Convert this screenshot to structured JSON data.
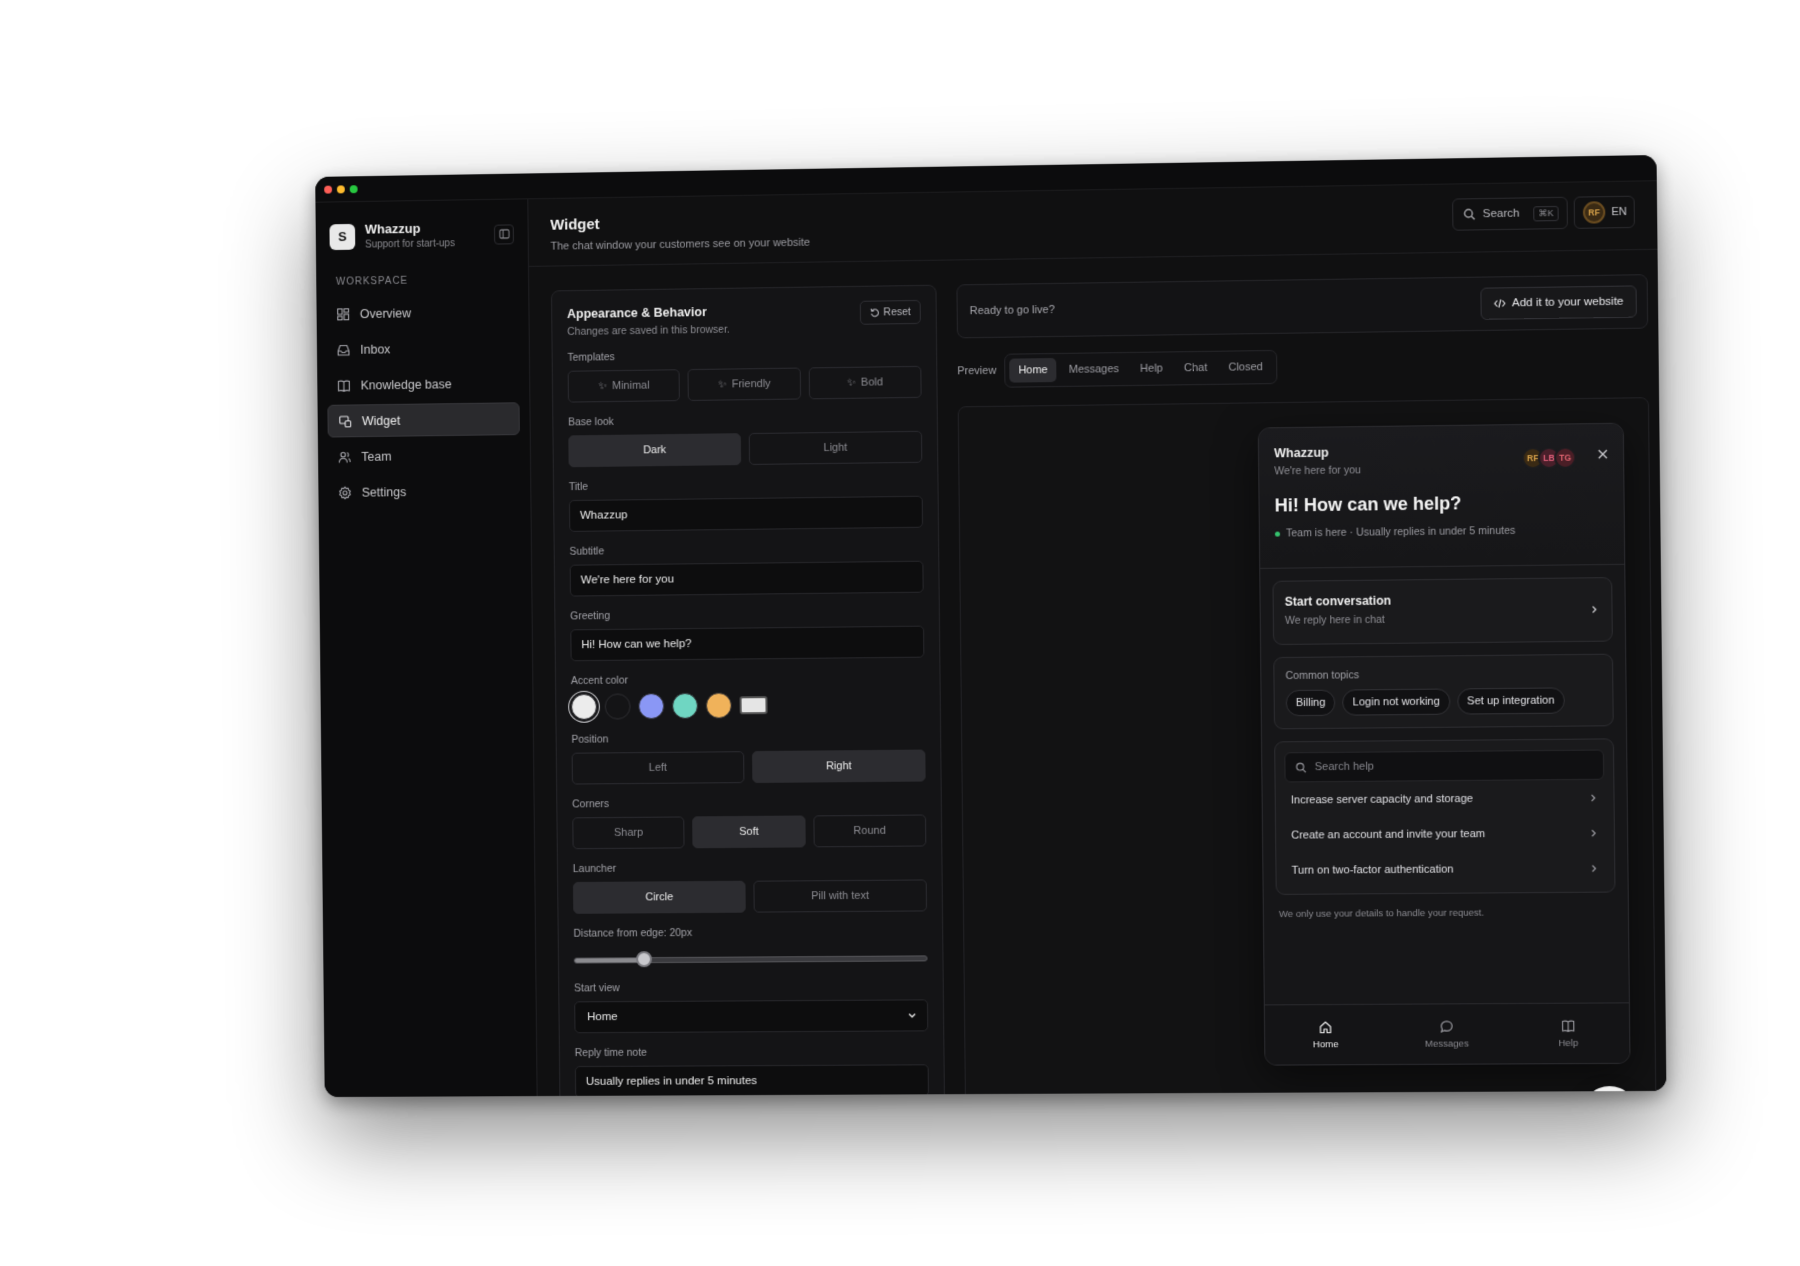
{
  "sidebar": {
    "brand": {
      "logo_letter": "S",
      "name": "Whazzup",
      "subtitle": "Support for start-ups"
    },
    "section_label": "WORKSPACE",
    "items": [
      {
        "label": "Overview",
        "icon": "grid-icon"
      },
      {
        "label": "Inbox",
        "icon": "inbox-icon"
      },
      {
        "label": "Knowledge base",
        "icon": "book-icon"
      },
      {
        "label": "Widget",
        "icon": "widget-icon",
        "active": true
      },
      {
        "label": "Team",
        "icon": "users-icon"
      },
      {
        "label": "Settings",
        "icon": "gear-icon"
      }
    ]
  },
  "header": {
    "title": "Widget",
    "subtitle": "The chat window your customers see on your website",
    "search_label": "Search",
    "search_shortcut": "⌘K",
    "user_initials": "RF",
    "language": "EN"
  },
  "settings": {
    "title": "Appearance & Behavior",
    "subtitle": "Changes are saved in this browser.",
    "reset_label": "Reset",
    "templates": {
      "label": "Templates",
      "options": [
        "Minimal",
        "Friendly",
        "Bold"
      ]
    },
    "base_look": {
      "label": "Base look",
      "options": [
        "Dark",
        "Light"
      ],
      "selected": "Dark"
    },
    "title_field": {
      "label": "Title",
      "value": "Whazzup"
    },
    "subtitle_field": {
      "label": "Subtitle",
      "value": "We're here for you"
    },
    "greeting_field": {
      "label": "Greeting",
      "value": "Hi! How can we help?"
    },
    "accent": {
      "label": "Accent color",
      "colors": [
        "#ececec",
        "#141416",
        "#8a97f5",
        "#6fd6c2",
        "#f0b25a"
      ],
      "selected": "#ececec"
    },
    "position": {
      "label": "Position",
      "options": [
        "Left",
        "Right"
      ],
      "selected": "Right"
    },
    "corners": {
      "label": "Corners",
      "options": [
        "Sharp",
        "Soft",
        "Round"
      ],
      "selected": "Soft"
    },
    "launcher": {
      "label": "Launcher",
      "options": [
        "Circle",
        "Pill with text"
      ],
      "selected": "Circle"
    },
    "distance": {
      "label": "Distance from edge: 20px",
      "value": 20,
      "min": 0,
      "max": 100
    },
    "start_view": {
      "label": "Start view",
      "value": "Home"
    },
    "reply_note": {
      "label": "Reply time note",
      "value": "Usually replies in under 5 minutes"
    }
  },
  "golive": {
    "text": "Ready to go live?",
    "button_label": "Add it to your website"
  },
  "preview": {
    "label": "Preview",
    "tabs": [
      "Home",
      "Messages",
      "Help",
      "Chat",
      "Closed"
    ],
    "active_tab": "Home"
  },
  "widget": {
    "title": "Whazzup",
    "subtitle": "We're here for you",
    "agents": [
      {
        "initials": "RF",
        "color": "#d7a24a",
        "bg": "#3a2a14"
      },
      {
        "initials": "LB",
        "color": "#e0607a",
        "bg": "#4a1f2a"
      },
      {
        "initials": "TG",
        "color": "#e06470",
        "bg": "#4a1e26"
      }
    ],
    "greeting": "Hi! How can we help?",
    "status": "Team is here · Usually replies in under 5 minutes",
    "start_title": "Start conversation",
    "start_sub": "We reply here in chat",
    "topics_label": "Common topics",
    "topics": [
      "Billing",
      "Login not working",
      "Set up integration"
    ],
    "help_placeholder": "Search help",
    "articles": [
      "Increase server capacity and storage",
      "Create an account and invite your team",
      "Turn on two-factor authentication"
    ],
    "note": "We only use your details to handle your request.",
    "nav": [
      "Home",
      "Messages",
      "Help"
    ],
    "active_nav": "Home"
  }
}
